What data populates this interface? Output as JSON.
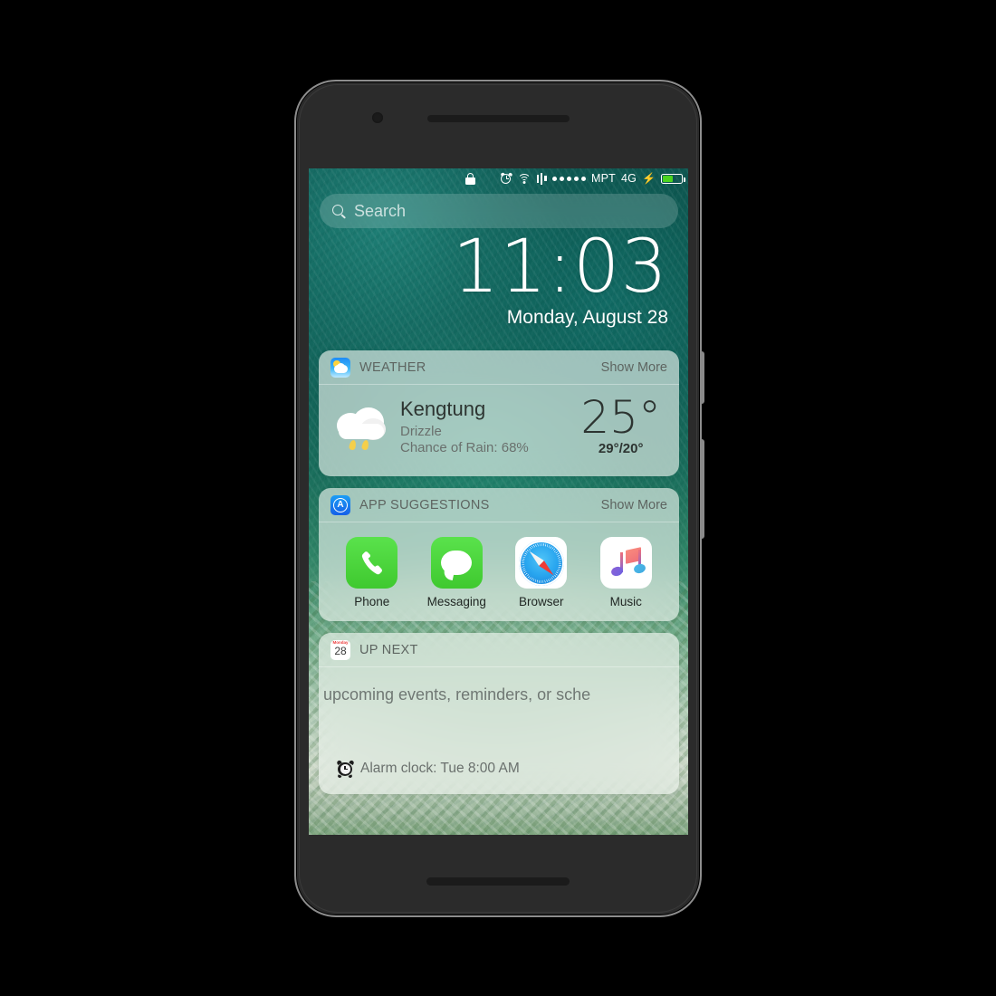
{
  "status_bar": {
    "lock_icon": "lock-icon",
    "alarm_icon": "alarm-clock-icon",
    "wifi_icon": "wifi-icon",
    "vibrate_icon": "vibrate-icon",
    "signal_dots": 5,
    "carrier": "MPT",
    "network": "4G",
    "charging_icon": "charging-bolt-icon",
    "battery_icon": "battery-icon",
    "battery_color": "#4cd41f"
  },
  "search": {
    "placeholder": "Search",
    "icon": "search-icon"
  },
  "lockscreen": {
    "time": "11:03",
    "date": "Monday, August 28"
  },
  "widgets": {
    "weather": {
      "header_icon": "weather-app-icon",
      "title": "WEATHER",
      "show_more": "Show More",
      "condition_icon": "rain-cloud-icon",
      "city": "Kengtung",
      "condition": "Drizzle",
      "chance_of_rain": "Chance of Rain: 68%",
      "temperature": "25°",
      "high_low": "29°/20°"
    },
    "app_suggestions": {
      "header_icon": "app-store-icon",
      "title": "APP SUGGESTIONS",
      "show_more": "Show More",
      "apps": [
        {
          "label": "Phone",
          "icon": "phone-icon"
        },
        {
          "label": "Messaging",
          "icon": "messages-icon"
        },
        {
          "label": "Browser",
          "icon": "safari-compass-icon"
        },
        {
          "label": "Music",
          "icon": "music-note-icon"
        }
      ]
    },
    "up_next": {
      "header_icon": "calendar-icon",
      "calendar_month": "Monday",
      "calendar_day": "28",
      "title": "UP NEXT",
      "empty_text": "ɔ upcoming events, reminders, or sche",
      "alarm_icon": "alarm-clock-emoji",
      "alarm_text": "Alarm clock: Tue 8:00 AM"
    }
  },
  "device": {
    "camera_icon": "front-camera-icon",
    "earpiece_icon": "earpiece-speaker-icon",
    "bottom_speaker_icon": "bottom-speaker-icon",
    "volume_button": "volume-button",
    "power_button": "power-button"
  }
}
